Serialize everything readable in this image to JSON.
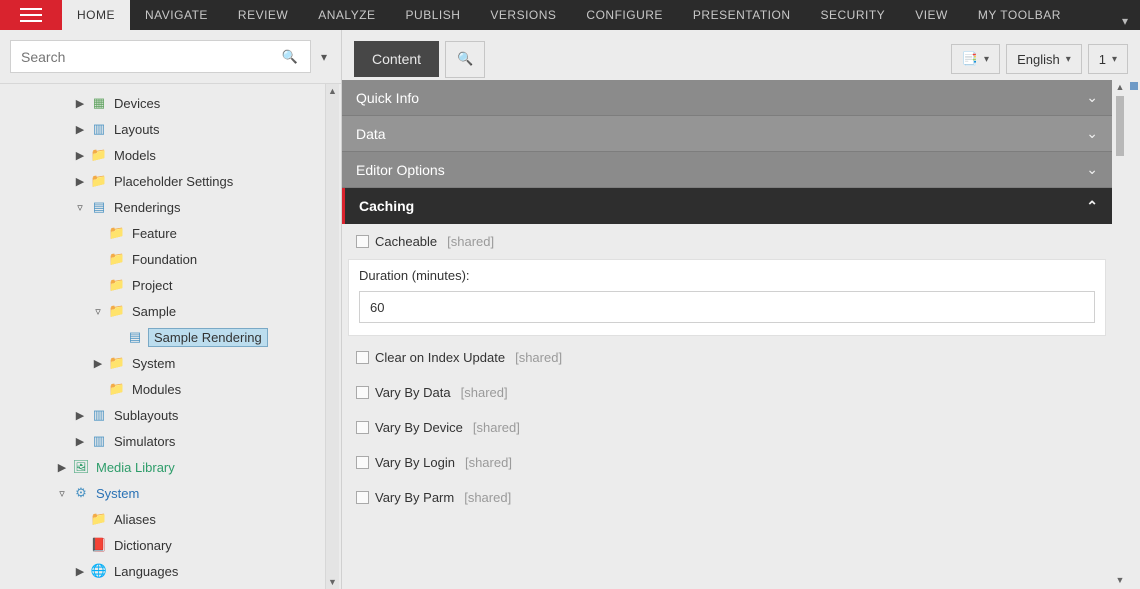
{
  "ribbon": {
    "tabs": [
      "HOME",
      "NAVIGATE",
      "REVIEW",
      "ANALYZE",
      "PUBLISH",
      "VERSIONS",
      "CONFIGURE",
      "PRESENTATION",
      "SECURITY",
      "VIEW",
      "MY TOOLBAR"
    ],
    "active": "HOME"
  },
  "search": {
    "placeholder": "Search"
  },
  "tree": [
    {
      "indent": 1,
      "arrow": "▶",
      "icon": "device",
      "label": "Devices"
    },
    {
      "indent": 1,
      "arrow": "▶",
      "icon": "layout",
      "label": "Layouts"
    },
    {
      "indent": 1,
      "arrow": "▶",
      "icon": "folder",
      "label": "Models"
    },
    {
      "indent": 1,
      "arrow": "▶",
      "icon": "folder",
      "label": "Placeholder Settings"
    },
    {
      "indent": 1,
      "arrow": "▿",
      "icon": "rendering",
      "label": "Renderings"
    },
    {
      "indent": 2,
      "arrow": "",
      "icon": "folder",
      "label": "Feature"
    },
    {
      "indent": 2,
      "arrow": "",
      "icon": "folder",
      "label": "Foundation"
    },
    {
      "indent": 2,
      "arrow": "",
      "icon": "folder",
      "label": "Project"
    },
    {
      "indent": 2,
      "arrow": "▿",
      "icon": "folder",
      "label": "Sample"
    },
    {
      "indent": 3,
      "arrow": "",
      "icon": "rendering",
      "label": "Sample Rendering",
      "selected": true
    },
    {
      "indent": 2,
      "arrow": "▶",
      "icon": "folder",
      "label": "System"
    },
    {
      "indent": 2,
      "arrow": "",
      "icon": "folder",
      "label": "Modules"
    },
    {
      "indent": 1,
      "arrow": "▶",
      "icon": "layout",
      "label": "Sublayouts"
    },
    {
      "indent": 1,
      "arrow": "▶",
      "icon": "layout",
      "label": "Simulators"
    },
    {
      "indent": 0,
      "arrow": "▶",
      "icon": "media",
      "label": "Media Library",
      "labelClass": "media-label"
    },
    {
      "indent": 0,
      "arrow": "▿",
      "icon": "system",
      "label": "System",
      "labelClass": "system-label"
    },
    {
      "indent": 1,
      "arrow": "",
      "icon": "folder",
      "label": "Aliases"
    },
    {
      "indent": 1,
      "arrow": "",
      "icon": "book",
      "label": "Dictionary"
    },
    {
      "indent": 1,
      "arrow": "▶",
      "icon": "lang",
      "label": "Languages"
    }
  ],
  "editor": {
    "tab_label": "Content",
    "lang": "English",
    "version": "1",
    "sections": {
      "quick_info": "Quick Info",
      "data": "Data",
      "editor_options": "Editor Options",
      "caching": "Caching"
    },
    "fields": {
      "cacheable": "Cacheable",
      "duration_label": "Duration (minutes):",
      "duration_value": "60",
      "clear_on_index": "Clear on Index Update",
      "vary_by_data": "Vary By Data",
      "vary_by_device": "Vary By Device",
      "vary_by_login": "Vary By Login",
      "vary_by_parm": "Vary By Parm",
      "shared_tag": "[shared]"
    }
  }
}
